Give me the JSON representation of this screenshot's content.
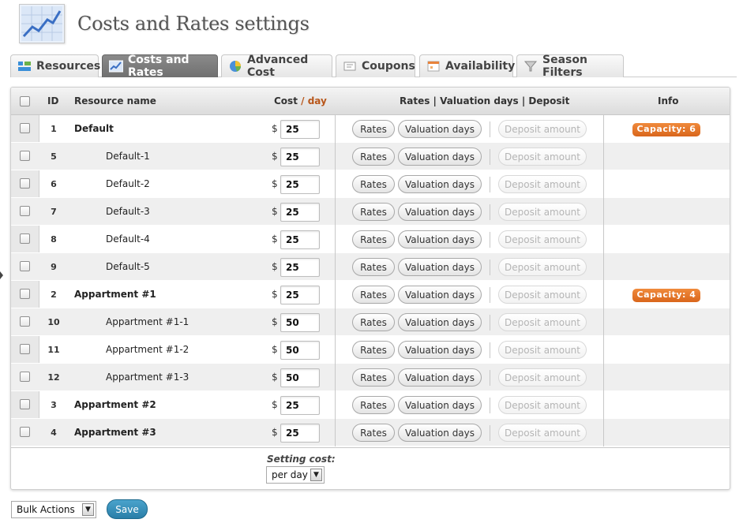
{
  "page": {
    "title": "Costs and Rates settings"
  },
  "tabs": [
    {
      "label": "Resources",
      "icon": "resources-icon",
      "active": false
    },
    {
      "label": "Costs and Rates",
      "icon": "chart-icon",
      "active": true
    },
    {
      "label": "Advanced Cost",
      "icon": "pie-chart-icon",
      "active": false
    },
    {
      "label": "Coupons",
      "icon": "coupon-icon",
      "active": false
    },
    {
      "label": "Availability",
      "icon": "calendar-icon",
      "active": false
    },
    {
      "label": "Season Filters",
      "icon": "filter-icon",
      "active": false
    }
  ],
  "table": {
    "headers": {
      "id": "ID",
      "name": "Resource name",
      "cost": "Cost",
      "cost_sep": " / ",
      "cost_unit": "day",
      "rates": "Rates | Valuation days | Deposit",
      "info": "Info"
    },
    "buttons": {
      "rates": "Rates",
      "valuation": "Valuation days",
      "deposit": "Deposit amount"
    },
    "currency": "$",
    "rows": [
      {
        "id": "1",
        "name": "Default",
        "level": "parent",
        "cost": "25",
        "info": "Capacity: 6"
      },
      {
        "id": "5",
        "name": "Default-1",
        "level": "child",
        "cost": "25",
        "info": ""
      },
      {
        "id": "6",
        "name": "Default-2",
        "level": "child",
        "cost": "25",
        "info": ""
      },
      {
        "id": "7",
        "name": "Default-3",
        "level": "child",
        "cost": "25",
        "info": ""
      },
      {
        "id": "8",
        "name": "Default-4",
        "level": "child",
        "cost": "25",
        "info": ""
      },
      {
        "id": "9",
        "name": "Default-5",
        "level": "child",
        "cost": "25",
        "info": ""
      },
      {
        "id": "2",
        "name": "Appartment #1",
        "level": "parent",
        "cost": "25",
        "info": "Capacity: 4"
      },
      {
        "id": "10",
        "name": "Appartment #1-1",
        "level": "child",
        "cost": "50",
        "info": ""
      },
      {
        "id": "11",
        "name": "Appartment #1-2",
        "level": "child",
        "cost": "50",
        "info": ""
      },
      {
        "id": "12",
        "name": "Appartment #1-3",
        "level": "child",
        "cost": "50",
        "info": ""
      },
      {
        "id": "3",
        "name": "Appartment #2",
        "level": "parent",
        "cost": "25",
        "info": ""
      },
      {
        "id": "4",
        "name": "Appartment #3",
        "level": "parent",
        "cost": "25",
        "info": ""
      }
    ],
    "footer": {
      "setting_label": "Setting cost:",
      "setting_value": "per day"
    }
  },
  "actions": {
    "bulk_label": "Bulk Actions",
    "save_label": "Save"
  },
  "colors": {
    "accent": "#2a7ea8",
    "badge": "#e0702a",
    "cost_unit": "#b8561a"
  }
}
